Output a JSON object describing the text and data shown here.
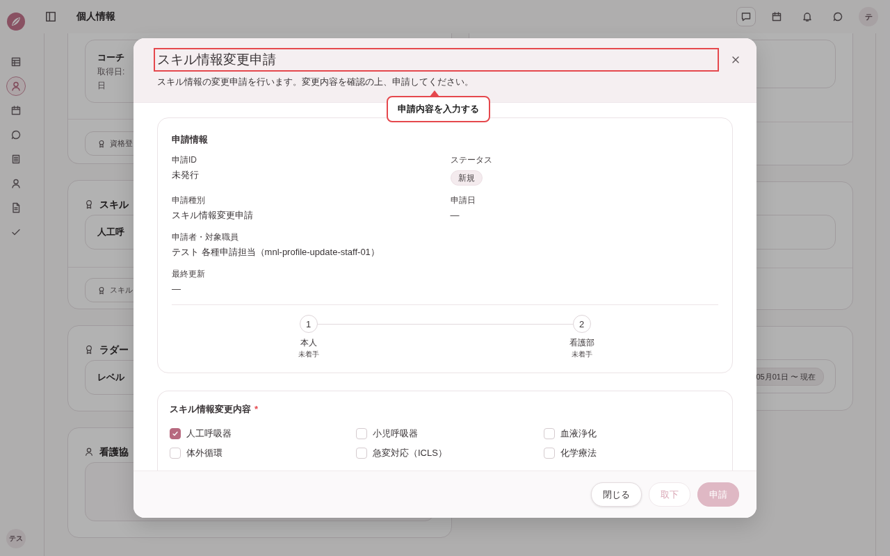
{
  "sidebar": {
    "items": [
      {
        "selected": false
      },
      {
        "selected": true
      },
      {
        "selected": false
      },
      {
        "selected": false
      },
      {
        "selected": false
      },
      {
        "selected": false
      },
      {
        "selected": false
      },
      {
        "selected": false
      }
    ],
    "avatar": "テス"
  },
  "header": {
    "title": "個人情報",
    "actions": [
      {
        "active": true
      },
      {
        "active": false
      },
      {
        "active": false
      },
      {
        "active": false
      }
    ],
    "avatar": "テ"
  },
  "profile": {
    "sections": [
      {
        "cards": [
          {
            "title": "コーチ",
            "lines": [
              "取得日:",
              "日"
            ]
          }
        ],
        "action": "資格登"
      },
      {
        "heading": "スキル",
        "cards": [
          {
            "title": "人工呼"
          }
        ],
        "action": "スキル"
      },
      {
        "heading": "ラダー",
        "cards": [
          {
            "title": "レベル"
          }
        ]
      },
      {
        "heading": "看護協",
        "empty_card": true
      }
    ],
    "period_badge": "05月01日 〜 現在"
  },
  "dialog": {
    "title": {
      "text": "スキル情報変更申請",
      "highlighted": true
    },
    "description": "スキル情報の変更申請を行います。変更内容を確認の上、申請してください。",
    "tooltip": "申請内容を入力する",
    "info": {
      "title": "申請情報",
      "rows": [
        [
          {
            "label": "申請ID",
            "value": "未発行",
            "kind": "text"
          },
          {
            "label": "ステータス",
            "value": "新規",
            "kind": "badge"
          }
        ],
        [
          {
            "label": "申請種別",
            "value": "スキル情報変更申請",
            "kind": "text"
          },
          {
            "label": "申請日",
            "value": "—",
            "kind": "text"
          }
        ],
        [
          {
            "label": "申請者・対象職員",
            "value": "テスト 各種申請担当（mnl-profile-update-staff-01）",
            "kind": "text"
          }
        ],
        [
          {
            "label": "最終更新",
            "value": "—",
            "kind": "text"
          }
        ]
      ],
      "steps": [
        {
          "number": "1",
          "label": "本人",
          "status": "未着手"
        },
        {
          "number": "2",
          "label": "看護部",
          "status": "未着手"
        }
      ]
    },
    "skills": {
      "title": "スキル情報変更内容",
      "required_mark": "*",
      "items": [
        {
          "label": "人工呼吸器",
          "checked": true
        },
        {
          "label": "小児呼吸器",
          "checked": false
        },
        {
          "label": "血液浄化",
          "checked": false
        },
        {
          "label": "体外循環",
          "checked": false
        },
        {
          "label": "急変対応（ICLS）",
          "checked": false
        },
        {
          "label": "化学療法",
          "checked": false
        }
      ]
    },
    "buttons": [
      {
        "label": "閉じる",
        "kind": "secondary",
        "disabled": false
      },
      {
        "label": "取下",
        "kind": "secondary",
        "disabled": true
      },
      {
        "label": "申請",
        "kind": "primary",
        "disabled": true
      }
    ]
  }
}
